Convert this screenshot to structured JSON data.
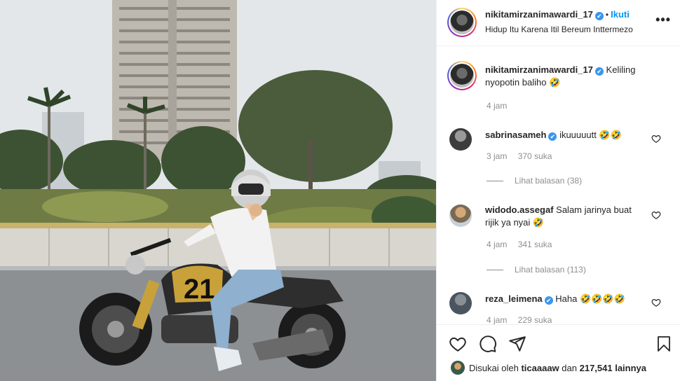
{
  "post": {
    "image_alt": "Woman in white helmet riding a black and gold motorcycle numbered 21 on a city road"
  },
  "bike": {
    "number": "21"
  },
  "header": {
    "username": "nikitamirzanimawardi_17",
    "verified_mark": "✔",
    "separator": "•",
    "follow_label": "Ikuti",
    "subtitle": "Hidup Itu Karena Itil Bereum Inttermezo",
    "more_label": "•••"
  },
  "caption": {
    "username": "nikitamirzanimawardi_17",
    "text": "Keliling nyopotin baliho 🤣",
    "time": "4 jam"
  },
  "comments": [
    {
      "username": "sabrinasameh",
      "verified": true,
      "text": "ikuuuuutt 🤣🤣",
      "time": "3 jam",
      "likes": "370 suka",
      "replies": "Lihat balasan (38)"
    },
    {
      "username": "widodo.assegaf",
      "verified": false,
      "text": "Salam jarinya buat rijik ya nyai 🤣",
      "time": "4 jam",
      "likes": "341 suka",
      "replies": "Lihat balasan (113)"
    },
    {
      "username": "reza_leimena",
      "verified": true,
      "text": "Haha 🤣🤣🤣🤣",
      "time": "4 jam",
      "likes": "229 suka"
    }
  ],
  "footer": {
    "liked_by_prefix": "Disukai oleh",
    "liked_by_user": "ticaaaaw",
    "liked_by_middle": "dan",
    "liked_by_count": "217,541 lainnya"
  },
  "colors": {
    "accent": "#0095f6",
    "verified": "#3897f0",
    "text": "#262626",
    "muted": "#8e8e8e",
    "border": "#efefef"
  },
  "icons": [
    "heart-icon",
    "comment-icon",
    "share-icon",
    "bookmark-icon",
    "more-icon",
    "verified-icon"
  ]
}
